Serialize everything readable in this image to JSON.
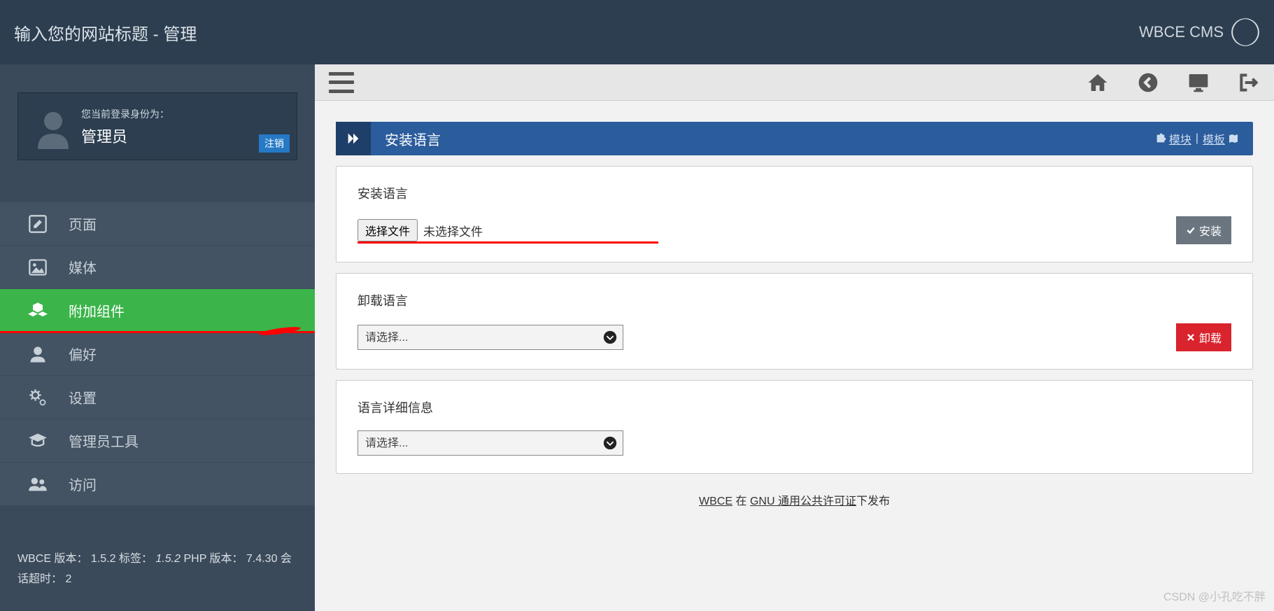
{
  "header": {
    "title": "输入您的网站标题 - 管理",
    "brand": "WBCE CMS"
  },
  "user": {
    "logged_in_as_label": "您当前登录身份为：",
    "role": "管理员",
    "logout_label": "注销"
  },
  "nav": {
    "items": [
      {
        "label": "页面"
      },
      {
        "label": "媒体"
      },
      {
        "label": "附加组件"
      },
      {
        "label": "偏好"
      },
      {
        "label": "设置"
      },
      {
        "label": "管理员工具"
      },
      {
        "label": "访问"
      }
    ]
  },
  "footer": {
    "wbce_version_label": "WBCE 版本：",
    "wbce_version": "1.5.2",
    "tag_label": "标签：",
    "tag": "1.5.2",
    "php_version_label": "PHP 版本：",
    "php_version": "7.4.30",
    "session_timeout_label": "会话超时：",
    "session_timeout": "2"
  },
  "page": {
    "title": "安装语言",
    "links": {
      "modules": "模块",
      "separator": "|",
      "templates": "模板"
    }
  },
  "install": {
    "title": "安装语言",
    "choose_file_label": "选择文件",
    "no_file_selected": "未选择文件",
    "install_button": "安装"
  },
  "uninstall": {
    "title": "卸载语言",
    "select_placeholder": "请选择...",
    "uninstall_button": "卸载"
  },
  "details": {
    "title": "语言详细信息",
    "select_placeholder": "请选择..."
  },
  "license": {
    "prefix_link": "WBCE",
    "middle_text": " 在 ",
    "license_link": "GNU 通用公共许可证",
    "suffix_text": "下发布"
  },
  "watermark": "CSDN @小孔吃不胖"
}
